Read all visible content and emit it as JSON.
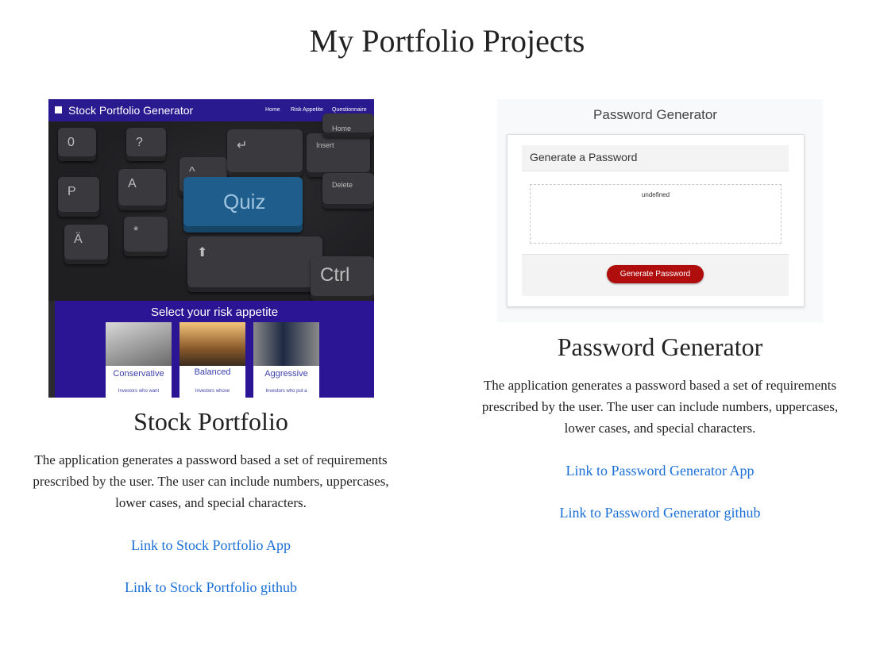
{
  "page": {
    "title": "My Portfolio Projects"
  },
  "projects": [
    {
      "title": "Stock Portfolio",
      "description": "The application generates a password based a set of requirements prescribed by the user. The user can include numbers, uppercases, lower cases, and special characters.",
      "app_link": "Link to Stock Portfolio App",
      "github_link": "Link to Stock Portfolio github",
      "screenshot": {
        "brand": "Stock Portfolio Generator",
        "nav": [
          "Home",
          "Risk Appetite",
          "Questionnaire"
        ],
        "keys": [
          "Quiz",
          "Ctrl",
          "P",
          "A",
          "Ä",
          "Delete",
          "Insert",
          "Home"
        ],
        "risk_title": "Select your risk appetite",
        "risk_cards": [
          {
            "label": "Conservative",
            "text": "Investors who want"
          },
          {
            "label": "Balanced",
            "text": "Investors whose"
          },
          {
            "label": "Aggressive",
            "text": "Investors who put a"
          }
        ]
      }
    },
    {
      "title": "Password Generator",
      "description": "The application generates a password based a set of requirements prescribed by the user. The user can include numbers, uppercases, lower cases, and special characters.",
      "app_link": "Link to Password Generator App",
      "github_link": "Link to Password Generator github",
      "screenshot": {
        "title": "Password Generator",
        "card_header": "Generate a Password",
        "output": "undefined",
        "button": "Generate Password"
      }
    }
  ],
  "colors": {
    "link": "#1a6fd6",
    "nav": "#2a1a8f",
    "button": "#b00d0d"
  }
}
